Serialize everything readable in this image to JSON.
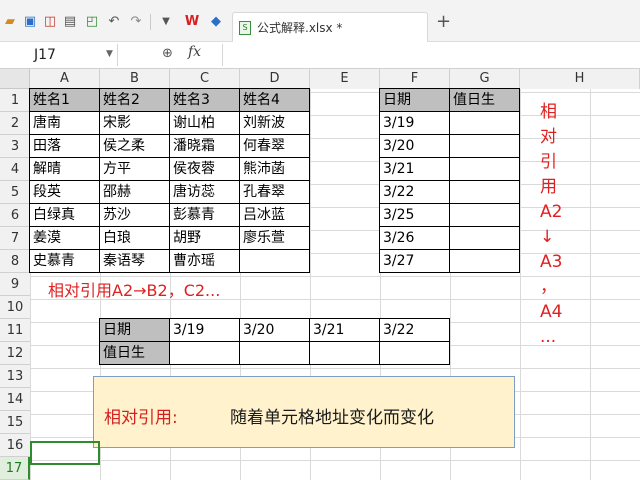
{
  "toolbar": {
    "file_tab": "公式解释.xlsx *",
    "add_tab": "+"
  },
  "formula_bar": {
    "name_box": "J17",
    "fx_label": "fx",
    "value": ""
  },
  "columns": [
    "A",
    "B",
    "C",
    "D",
    "E",
    "F",
    "G",
    "H"
  ],
  "rows": [
    "1",
    "2",
    "3",
    "4",
    "5",
    "6",
    "7",
    "8",
    "9",
    "10",
    "11",
    "12",
    "13",
    "14",
    "15",
    "16",
    "17"
  ],
  "names_table": {
    "headers": [
      "姓名1",
      "姓名2",
      "姓名3",
      "姓名4"
    ],
    "rows": [
      [
        "唐南",
        "宋影",
        "谢山柏",
        "刘新波"
      ],
      [
        "田落",
        "侯之柔",
        "潘晓霜",
        "何春翠"
      ],
      [
        "解晴",
        "方平",
        "侯夜蓉",
        "熊沛菡"
      ],
      [
        "段英",
        "邵赫",
        "唐访蕊",
        "孔春翠"
      ],
      [
        "白绿真",
        "苏沙",
        "彭慕青",
        "吕冰蓝"
      ],
      [
        "姜漠",
        "白琅",
        "胡野",
        "廖乐萱"
      ],
      [
        "史慕青",
        "秦语琴",
        "曹亦瑶",
        ""
      ]
    ]
  },
  "duty_table": {
    "headers": [
      "日期",
      "值日生"
    ],
    "rows": [
      [
        "3/19",
        ""
      ],
      [
        "3/20",
        ""
      ],
      [
        "3/21",
        ""
      ],
      [
        "3/22",
        ""
      ],
      [
        "3/25",
        ""
      ],
      [
        "3/26",
        ""
      ],
      [
        "3/27",
        ""
      ]
    ]
  },
  "note_line": "相对引用A2→B2，C2...",
  "vertical_note": [
    "相",
    "对",
    "引",
    "用",
    "A2",
    "↓",
    "A3",
    "，",
    "A4",
    "..."
  ],
  "horizontal_table": {
    "row1_label": "日期",
    "row1_values": [
      "3/19",
      "3/20",
      "3/21",
      "3/22"
    ],
    "row2_label": "值日生",
    "row2_values": [
      "",
      "",
      "",
      ""
    ]
  },
  "callout": {
    "label": "相对引用:",
    "text": "随着单元格地址变化而变化"
  },
  "colors": {
    "header_fill": "#bfbfbf",
    "accent_red": "#e02020",
    "callout_fill": "#fff2cc",
    "selection_green": "#2e8b2e"
  }
}
